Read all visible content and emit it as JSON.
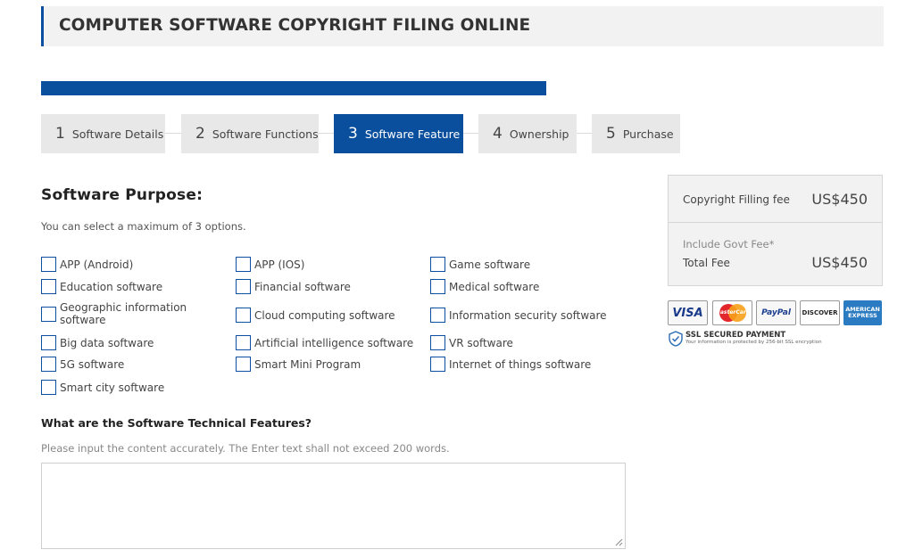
{
  "header": {
    "title": "COMPUTER SOFTWARE COPYRIGHT FILING ONLINE"
  },
  "steps": [
    {
      "num": "1",
      "label": "Software Details"
    },
    {
      "num": "2",
      "label": "Software Functions"
    },
    {
      "num": "3",
      "label": "Software Feature"
    },
    {
      "num": "4",
      "label": "Ownership"
    },
    {
      "num": "5",
      "label": "Purchase"
    }
  ],
  "purpose": {
    "title": "Software Purpose:",
    "hint": "You can select a maximum of 3 options.",
    "options": [
      "APP (Android)",
      "APP (IOS)",
      "Game software",
      "Education software",
      "Financial software",
      "Medical software",
      "Geographic information software",
      "Cloud computing software",
      "Information security software",
      "Big data software",
      "Artificial intelligence software",
      "VR software",
      "5G software",
      "Smart Mini Program",
      "Internet of things software",
      "Smart city software"
    ]
  },
  "features": {
    "title": "What are the Software Technical Features?",
    "hint": "Please input the content accurately. The Enter text shall not exceed 200 words.",
    "value": ""
  },
  "fees": {
    "filing_label": "Copyright Filling fee",
    "filing_amount": "US$450",
    "govt_note": "Include Govt Fee*",
    "total_label": "Total Fee",
    "total_amount": "US$450"
  },
  "cards": [
    "VISA",
    "MasterCard",
    "PayPal",
    "DISCOVER",
    "AMERICAN EXPRESS"
  ],
  "ssl": {
    "title": "SSL SECURED PAYMENT",
    "subtitle": "Your information is protected by 256-bit SSL encryption"
  },
  "colors": {
    "accent": "#0a4f9e",
    "step_inactive": "#e8e8e8",
    "panel": "#f2f2f2"
  }
}
